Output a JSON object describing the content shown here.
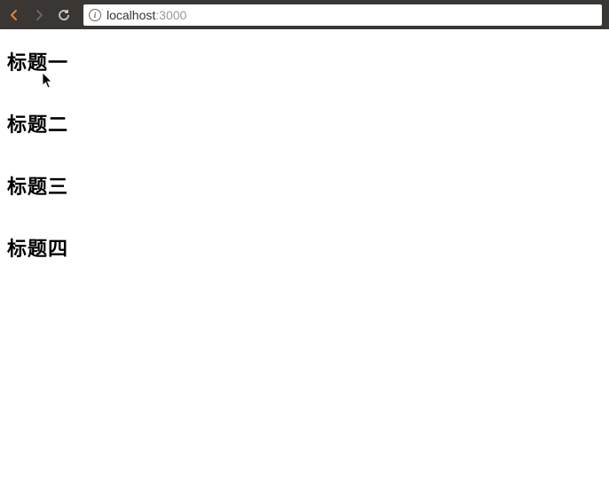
{
  "browser": {
    "url_host": "localhost",
    "url_port": ":3000"
  },
  "page": {
    "headings": [
      "标题一",
      "标题二",
      "标题三",
      "标题四"
    ]
  }
}
